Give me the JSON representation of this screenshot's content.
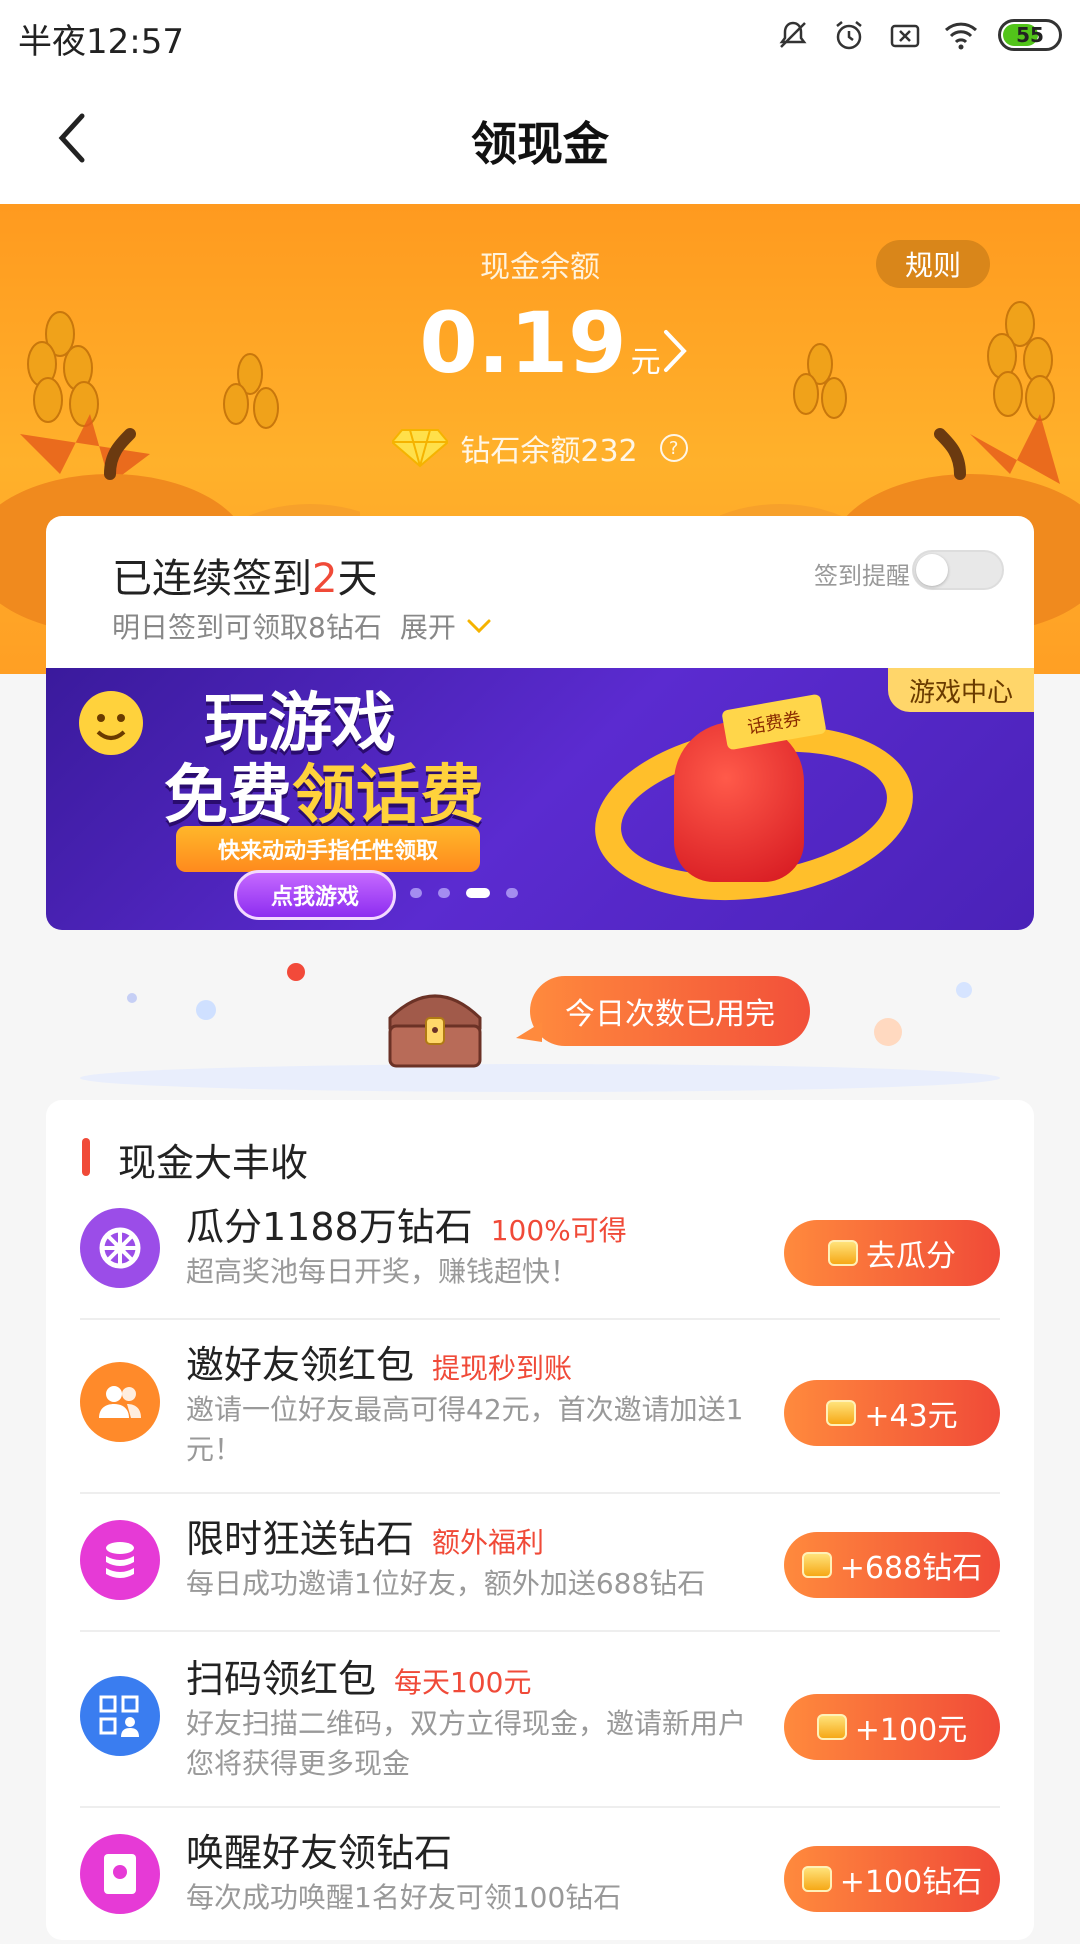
{
  "status_bar": {
    "time": "半夜12:57",
    "battery": "55",
    "icons": [
      "mute-icon",
      "alarm-icon",
      "sim-x-icon",
      "wifi-icon",
      "battery-icon"
    ]
  },
  "nav": {
    "title": "领现金",
    "back_icon": "chevron-left-icon"
  },
  "hero": {
    "balance_label": "现金余额",
    "balance_value": "0.19",
    "balance_unit": "元",
    "rule_label": "规则",
    "diamond_text": "钻石余额232",
    "help_symbol": "?"
  },
  "checkin": {
    "streak_prefix": "已连续签到",
    "streak_days": "2",
    "streak_suffix": "天",
    "tomorrow_text": "明日签到可领取8钻石",
    "expand_label": "展开",
    "remind_label": "签到提醒",
    "remind_on": false
  },
  "banner": {
    "tag": "游戏中心",
    "headline_line1": "玩游戏",
    "headline_free": "免费",
    "headline_highlight": "领话费",
    "ribbon_text": "快来动动手指任性领取",
    "play_button": "点我游戏",
    "hat_text": "话费券",
    "slides": 4,
    "active_slide": 3
  },
  "chest": {
    "bubble_text": "今日次数已用完"
  },
  "tasks": {
    "section_title": "现金大丰收",
    "items": [
      {
        "title": "瓜分1188万钻石",
        "tag": "100%可得",
        "desc": "超高奖池每日开奖，赚钱超快！",
        "button": "去瓜分",
        "icon": "wheel-icon",
        "color": "#9b4de8"
      },
      {
        "title": "邀好友领红包",
        "tag": "提现秒到账",
        "desc": "邀请一位好友最高可得42元，首次邀请加送1元！",
        "button": "+43元",
        "icon": "friends-icon",
        "color": "#ff8a2a"
      },
      {
        "title": "限时狂送钻石",
        "tag": "额外福利",
        "desc": "每日成功邀请1位好友，额外加送688钻石",
        "button": "+688钻石",
        "icon": "coin-stack-icon",
        "color": "#e63ad6"
      },
      {
        "title": "扫码领红包",
        "tag": "每天100元",
        "desc": "好友扫描二维码，双方立得现金，邀请新用户您将获得更多现金",
        "button": "+100元",
        "icon": "qr-user-icon",
        "color": "#3a7df0"
      },
      {
        "title": "唤醒好友领钻石",
        "tag": "",
        "desc": "每次成功唤醒1名好友可领100钻石",
        "button": "+100钻石",
        "icon": "red-envelope-icon",
        "color": "#e63ad6"
      }
    ]
  }
}
